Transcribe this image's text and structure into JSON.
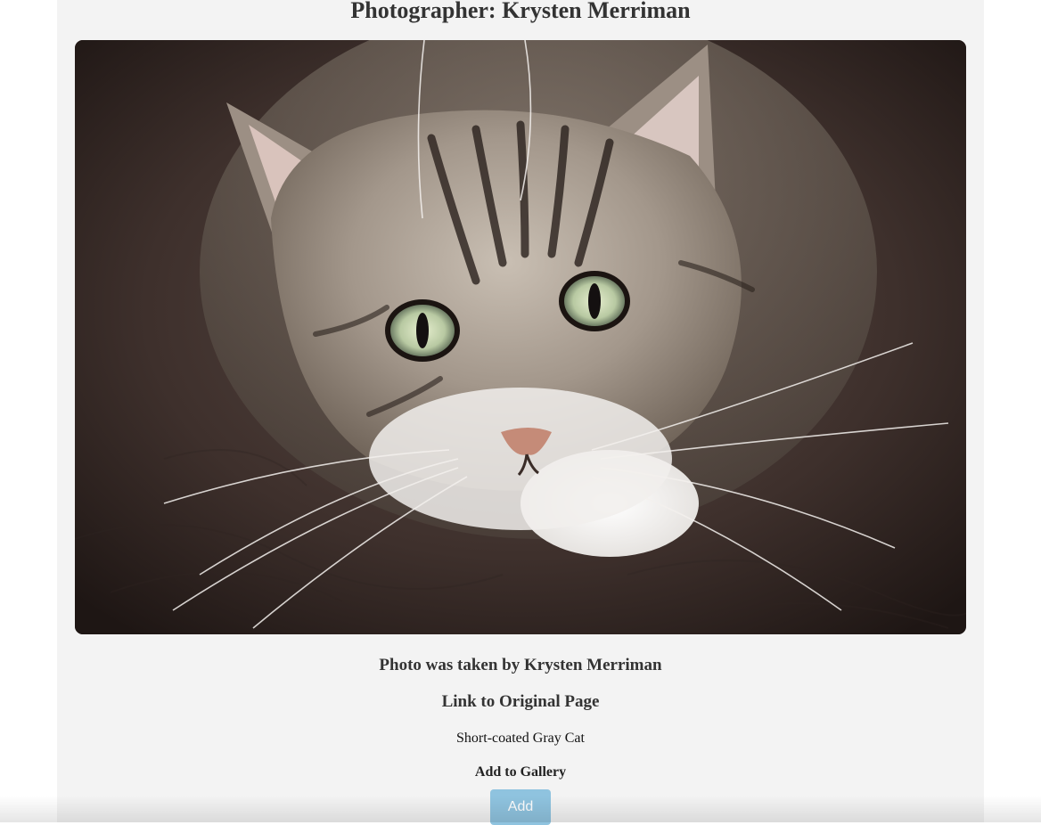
{
  "header": {
    "title": "Photographer: Krysten Merriman"
  },
  "photo": {
    "icon": "tabby-cat-photo",
    "alt": "Short-coated Gray Cat"
  },
  "details": {
    "credit": "Photo was taken by Krysten Merriman",
    "link_label": "Link to Original Page",
    "description": "Short-coated Gray Cat"
  },
  "gallery": {
    "heading": "Add to Gallery",
    "button_label": "Add"
  },
  "colors": {
    "panel_background": "#f3f3f3",
    "button_background": "#8fc3df",
    "text": "#333333"
  }
}
